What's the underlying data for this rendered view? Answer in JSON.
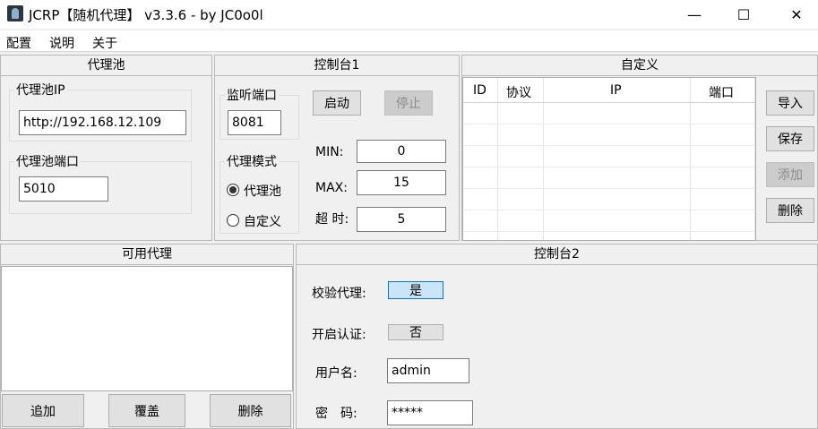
{
  "window": {
    "title": "JCRP【随机代理】 v3.3.6 - by JC0o0l",
    "minimize_glyph": "—",
    "maximize_glyph": "☐",
    "close_glyph": "✕"
  },
  "menu": [
    "配置",
    "说明",
    "关于"
  ],
  "proxy_pool": {
    "header": "代理池",
    "ip_label": "代理池IP",
    "ip_value": "http://192.168.12.109",
    "port_label": "代理池端口",
    "port_value": "5010"
  },
  "console1": {
    "header": "控制台1",
    "listen_port_label": "监听端口",
    "listen_port_value": "8081",
    "start_label": "启动",
    "stop_label": "停止",
    "mode_label": "代理模式",
    "mode_pool_label": "代理池",
    "mode_custom_label": "自定义",
    "mode_selected": "代理池",
    "min_label": "MIN:",
    "min_value": "0",
    "max_label": "MAX:",
    "max_value": "15",
    "timeout_label": "超 时:",
    "timeout_value": "5"
  },
  "custom": {
    "header": "自定义",
    "columns": [
      "ID",
      "协议",
      "IP",
      "端口"
    ],
    "import_label": "导入",
    "save_label": "保存",
    "add_label": "添加",
    "delete_label": "删除"
  },
  "available": {
    "header": "可用代理",
    "append_label": "追加",
    "overwrite_label": "覆盖",
    "delete_label": "删除"
  },
  "console2": {
    "header": "控制台2",
    "verify_label": "校验代理:",
    "verify_value": "是",
    "auth_label": "开启认证:",
    "auth_value": "否",
    "username_label": "用户名:",
    "username_value": "admin",
    "password_label": "密　码:",
    "password_value": "*****"
  },
  "colors": {
    "window_bg": "#f0f0f0",
    "accent": "#0078d7",
    "toggle_on_bg": "#cce4f7"
  }
}
